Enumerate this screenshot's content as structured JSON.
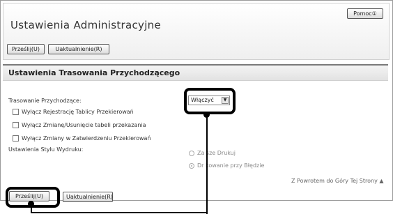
{
  "header": {
    "title": "Ustawienia Administracyjne",
    "help_label": "Pomoc①",
    "submit_label": "Prześlij(U)",
    "update_label": "Uaktualnienie(R)"
  },
  "section": {
    "title": "Ustawienia Trasowania Przychodzącego"
  },
  "form": {
    "routing_label": "Trasowanie Przychodzące:",
    "routing_value": "Włączyć",
    "checkboxes": [
      "Wyłącz Rejestrację Tablicy Przekierowań",
      "Wyłącz Zmianę/Usunięcie tabeli przekazania",
      "Wyłącz Zmiany w Zatwierdzeniu Przekierowań"
    ],
    "print_style_label": "Ustawienia Stylu Wydruku:",
    "radio_options": [
      {
        "label": "Za  sze Drukuj",
        "selected": false
      },
      {
        "label": "Dr  kowanie przy Błędzie",
        "selected": true
      }
    ]
  },
  "footer": {
    "back_to_top": "Z Powrotem do Góry Tej Strony",
    "up_icon": "up-triangle-icon",
    "submit_label": "Prześlij(U)",
    "update_label": "Uaktualnienie(R)"
  }
}
